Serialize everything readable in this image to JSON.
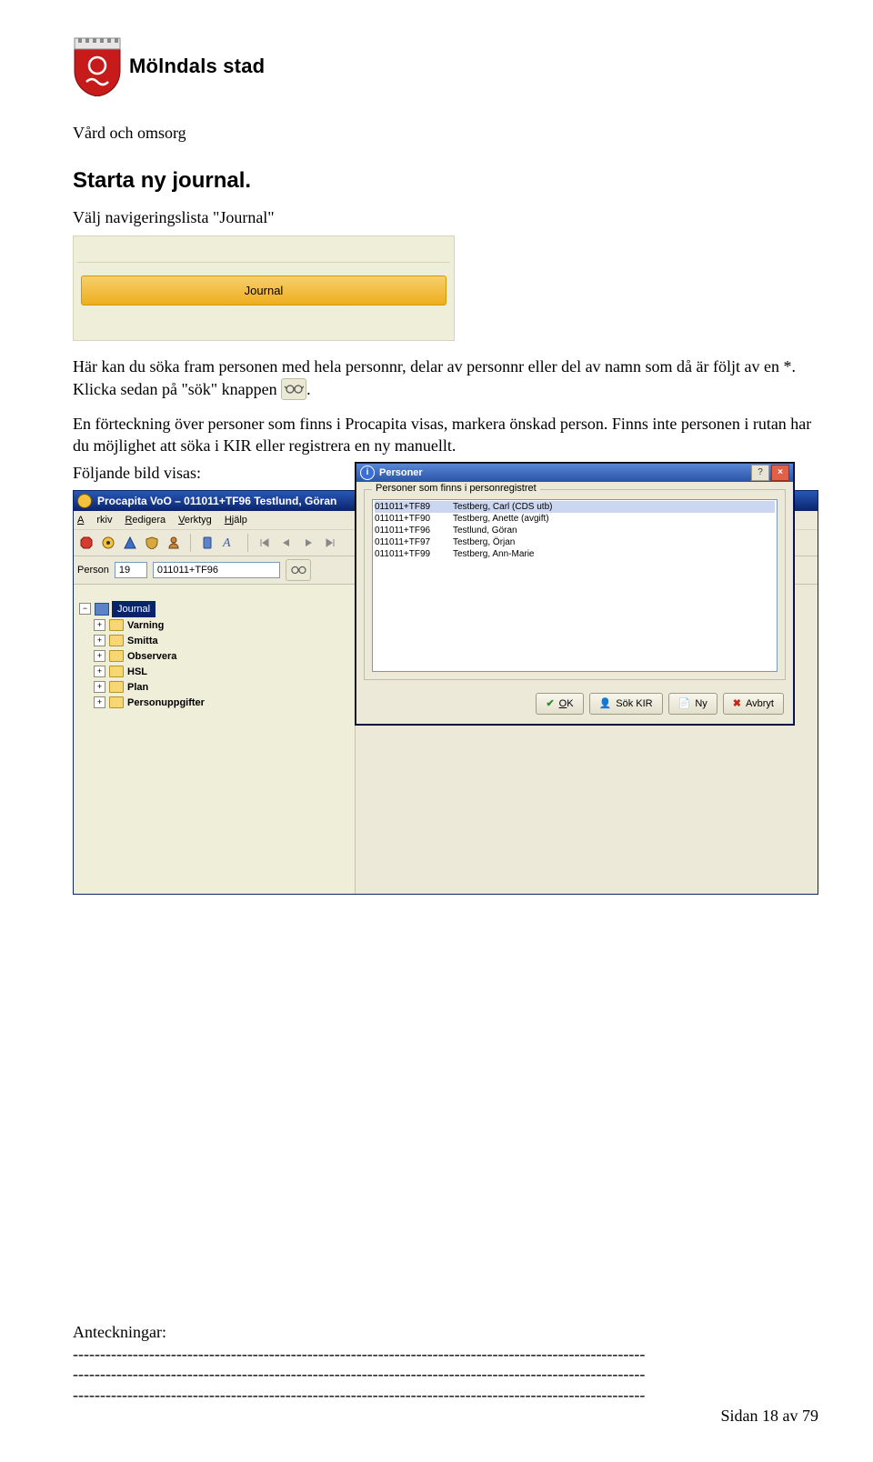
{
  "org_name": "Mölndals stad",
  "section": "Vård och omsorg",
  "page_title": "Starta ny journal.",
  "intro_line": "Välj navigeringslista \"Journal\"",
  "navlist": {
    "item_label": "Journal"
  },
  "para1": "Här kan du söka fram personen med hela personnr, delar av personnr eller del av namn som då är följt av en *. Klicka sedan på \"sök\" knappen ",
  "para1_suffix": ".",
  "para2": "En förteckning över personer som finns i Procapita visas, markera önskad person. Finns inte personen i rutan har du möjlighet att söka i KIR eller registrera en ny manuellt.",
  "para3": "Följande bild visas:",
  "app": {
    "titlebar": "Procapita VoO – 011011+TF96 Testlund, Göran",
    "menus": {
      "arkiv": "Arkiv",
      "redigera": "Redigera",
      "verktyg": "Verktyg",
      "hjalp": "Hjälp"
    },
    "toolbar_labels": {
      "person": "Person"
    },
    "person_code_field": "19",
    "person_id_field": "011011+TF96",
    "tree": {
      "root": "Journal",
      "items": [
        "Varning",
        "Smitta",
        "Observera",
        "HSL",
        "Plan",
        "Personuppgifter"
      ]
    }
  },
  "dialog": {
    "title": "Personer",
    "help_glyph": "?",
    "close_glyph": "×",
    "group_label": "Personer som finns i personregistret",
    "rows": [
      {
        "id": "011011+TF89",
        "name": "Testberg, Carl (CDS utb)"
      },
      {
        "id": "011011+TF90",
        "name": "Testberg, Anette (avgift)"
      },
      {
        "id": "011011+TF96",
        "name": "Testlund, Göran"
      },
      {
        "id": "011011+TF97",
        "name": "Testberg, Örjan"
      },
      {
        "id": "011011+TF99",
        "name": "Testberg, Ann-Marie"
      }
    ],
    "buttons": {
      "ok": "OK",
      "sok_kir": "Sök KIR",
      "ny": "Ny",
      "avbryt": "Avbryt"
    }
  },
  "notes_label": "Anteckningar:",
  "dash_row": "---------------------------------------------------------------------------------------------------------",
  "page_number": "Sidan 18 av 79"
}
